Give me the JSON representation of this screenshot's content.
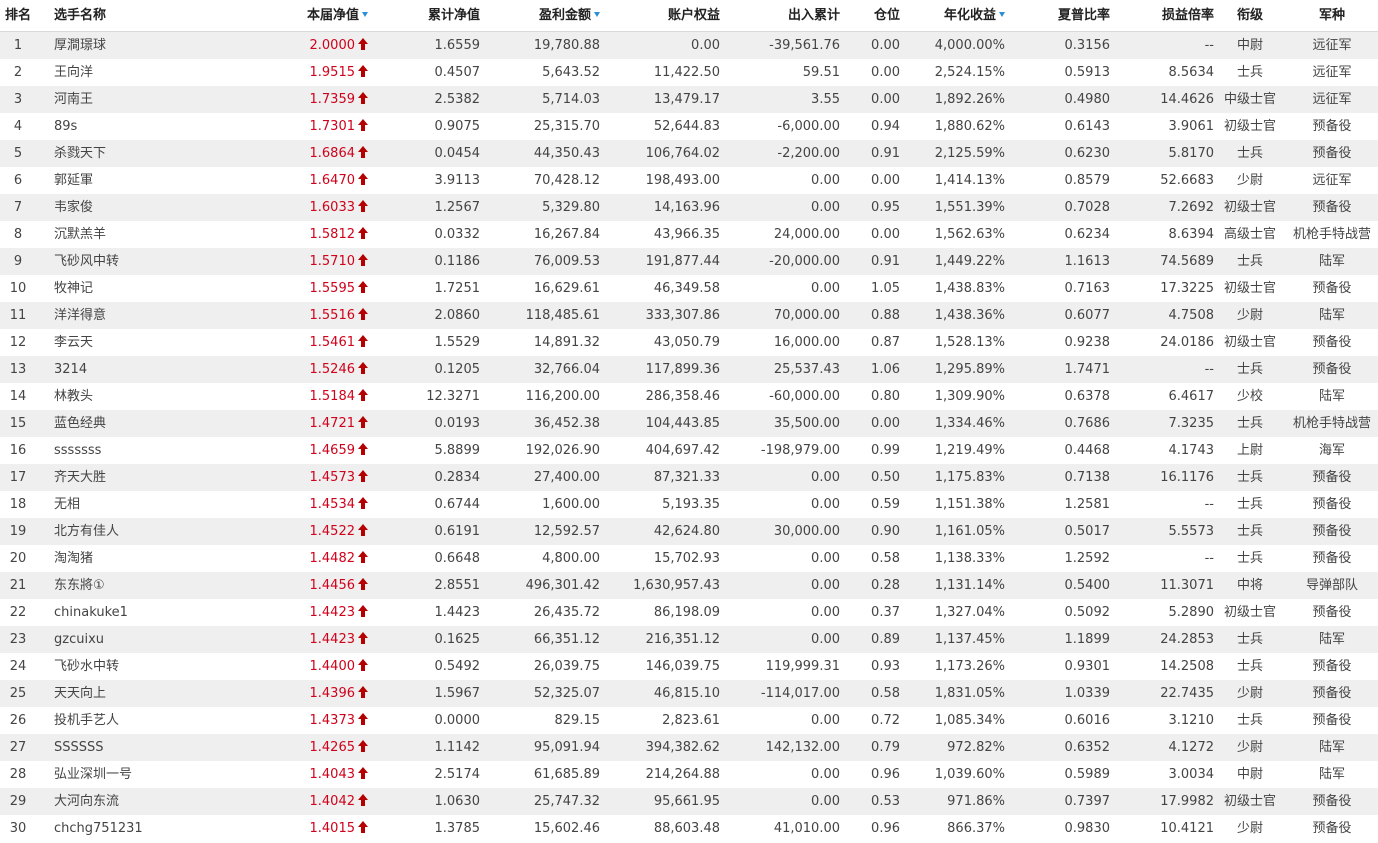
{
  "headers": {
    "rank": "排名",
    "name": "选手名称",
    "net": "本届净值",
    "cum": "累计净值",
    "profit": "盈利金额",
    "equity": "账户权益",
    "flow": "出入累计",
    "pos": "仓位",
    "annual": "年化收益",
    "sharpe": "夏普比率",
    "pl": "损益倍率",
    "rankname": "衔级",
    "branch": "军种"
  },
  "colors": {
    "accent": "#d0021b",
    "arrow": "#b40000",
    "sort": "#2a8fd6",
    "stripe": "#efefef"
  },
  "icons": {
    "sort": "sort-desc-icon",
    "trend": "up-arrow-icon"
  },
  "rows": [
    {
      "rank": "1",
      "name": "厚澗璟球",
      "net": "2.0000",
      "cum": "1.6559",
      "profit": "19,780.88",
      "equity": "0.00",
      "flow": "-39,561.76",
      "pos": "0.00",
      "annual": "4,000.00%",
      "sharpe": "0.3156",
      "pl": "--",
      "rankname": "中尉",
      "branch": "远征军"
    },
    {
      "rank": "2",
      "name": "王向洋",
      "net": "1.9515",
      "cum": "0.4507",
      "profit": "5,643.52",
      "equity": "11,422.50",
      "flow": "59.51",
      "pos": "0.00",
      "annual": "2,524.15%",
      "sharpe": "0.5913",
      "pl": "8.5634",
      "rankname": "士兵",
      "branch": "远征军"
    },
    {
      "rank": "3",
      "name": "河南王",
      "net": "1.7359",
      "cum": "2.5382",
      "profit": "5,714.03",
      "equity": "13,479.17",
      "flow": "3.55",
      "pos": "0.00",
      "annual": "1,892.26%",
      "sharpe": "0.4980",
      "pl": "14.4626",
      "rankname": "中级士官",
      "branch": "远征军"
    },
    {
      "rank": "4",
      "name": "89s",
      "net": "1.7301",
      "cum": "0.9075",
      "profit": "25,315.70",
      "equity": "52,644.83",
      "flow": "-6,000.00",
      "pos": "0.94",
      "annual": "1,880.62%",
      "sharpe": "0.6143",
      "pl": "3.9061",
      "rankname": "初级士官",
      "branch": "预备役"
    },
    {
      "rank": "5",
      "name": "杀戮天下",
      "net": "1.6864",
      "cum": "0.0454",
      "profit": "44,350.43",
      "equity": "106,764.02",
      "flow": "-2,200.00",
      "pos": "0.91",
      "annual": "2,125.59%",
      "sharpe": "0.6230",
      "pl": "5.8170",
      "rankname": "士兵",
      "branch": "预备役"
    },
    {
      "rank": "6",
      "name": "郭延軍",
      "net": "1.6470",
      "cum": "3.9113",
      "profit": "70,428.12",
      "equity": "198,493.00",
      "flow": "0.00",
      "pos": "0.00",
      "annual": "1,414.13%",
      "sharpe": "0.8579",
      "pl": "52.6683",
      "rankname": "少尉",
      "branch": "远征军"
    },
    {
      "rank": "7",
      "name": "韦家俊",
      "net": "1.6033",
      "cum": "1.2567",
      "profit": "5,329.80",
      "equity": "14,163.96",
      "flow": "0.00",
      "pos": "0.95",
      "annual": "1,551.39%",
      "sharpe": "0.7028",
      "pl": "7.2692",
      "rankname": "初级士官",
      "branch": "预备役"
    },
    {
      "rank": "8",
      "name": "沉默羔羊",
      "net": "1.5812",
      "cum": "0.0332",
      "profit": "16,267.84",
      "equity": "43,966.35",
      "flow": "24,000.00",
      "pos": "0.00",
      "annual": "1,562.63%",
      "sharpe": "0.6234",
      "pl": "8.6394",
      "rankname": "高级士官",
      "branch": "机枪手特战营"
    },
    {
      "rank": "9",
      "name": "飞砂风中转",
      "net": "1.5710",
      "cum": "0.1186",
      "profit": "76,009.53",
      "equity": "191,877.44",
      "flow": "-20,000.00",
      "pos": "0.91",
      "annual": "1,449.22%",
      "sharpe": "1.1613",
      "pl": "74.5689",
      "rankname": "士兵",
      "branch": "陆军"
    },
    {
      "rank": "10",
      "name": "牧神记",
      "net": "1.5595",
      "cum": "1.7251",
      "profit": "16,629.61",
      "equity": "46,349.58",
      "flow": "0.00",
      "pos": "1.05",
      "annual": "1,438.83%",
      "sharpe": "0.7163",
      "pl": "17.3225",
      "rankname": "初级士官",
      "branch": "预备役"
    },
    {
      "rank": "11",
      "name": "洋洋得意",
      "net": "1.5516",
      "cum": "2.0860",
      "profit": "118,485.61",
      "equity": "333,307.86",
      "flow": "70,000.00",
      "pos": "0.88",
      "annual": "1,438.36%",
      "sharpe": "0.6077",
      "pl": "4.7508",
      "rankname": "少尉",
      "branch": "陆军"
    },
    {
      "rank": "12",
      "name": "李云天",
      "net": "1.5461",
      "cum": "1.5529",
      "profit": "14,891.32",
      "equity": "43,050.79",
      "flow": "16,000.00",
      "pos": "0.87",
      "annual": "1,528.13%",
      "sharpe": "0.9238",
      "pl": "24.0186",
      "rankname": "初级士官",
      "branch": "预备役"
    },
    {
      "rank": "13",
      "name": "3214",
      "net": "1.5246",
      "cum": "0.1205",
      "profit": "32,766.04",
      "equity": "117,899.36",
      "flow": "25,537.43",
      "pos": "1.06",
      "annual": "1,295.89%",
      "sharpe": "1.7471",
      "pl": "--",
      "rankname": "士兵",
      "branch": "预备役"
    },
    {
      "rank": "14",
      "name": "林教头",
      "net": "1.5184",
      "cum": "12.3271",
      "profit": "116,200.00",
      "equity": "286,358.46",
      "flow": "-60,000.00",
      "pos": "0.80",
      "annual": "1,309.90%",
      "sharpe": "0.6378",
      "pl": "6.4617",
      "rankname": "少校",
      "branch": "陆军"
    },
    {
      "rank": "15",
      "name": "蓝色经典",
      "net": "1.4721",
      "cum": "0.0193",
      "profit": "36,452.38",
      "equity": "104,443.85",
      "flow": "35,500.00",
      "pos": "0.00",
      "annual": "1,334.46%",
      "sharpe": "0.7686",
      "pl": "7.3235",
      "rankname": "士兵",
      "branch": "机枪手特战营"
    },
    {
      "rank": "16",
      "name": "sssssss",
      "net": "1.4659",
      "cum": "5.8899",
      "profit": "192,026.90",
      "equity": "404,697.42",
      "flow": "-198,979.00",
      "pos": "0.99",
      "annual": "1,219.49%",
      "sharpe": "0.4468",
      "pl": "4.1743",
      "rankname": "上尉",
      "branch": "海军"
    },
    {
      "rank": "17",
      "name": "齐天大胜",
      "net": "1.4573",
      "cum": "0.2834",
      "profit": "27,400.00",
      "equity": "87,321.33",
      "flow": "0.00",
      "pos": "0.50",
      "annual": "1,175.83%",
      "sharpe": "0.7138",
      "pl": "16.1176",
      "rankname": "士兵",
      "branch": "预备役"
    },
    {
      "rank": "18",
      "name": "无相",
      "net": "1.4534",
      "cum": "0.6744",
      "profit": "1,600.00",
      "equity": "5,193.35",
      "flow": "0.00",
      "pos": "0.59",
      "annual": "1,151.38%",
      "sharpe": "1.2581",
      "pl": "--",
      "rankname": "士兵",
      "branch": "预备役"
    },
    {
      "rank": "19",
      "name": "北方有佳人",
      "net": "1.4522",
      "cum": "0.6191",
      "profit": "12,592.57",
      "equity": "42,624.80",
      "flow": "30,000.00",
      "pos": "0.90",
      "annual": "1,161.05%",
      "sharpe": "0.5017",
      "pl": "5.5573",
      "rankname": "士兵",
      "branch": "预备役"
    },
    {
      "rank": "20",
      "name": "淘淘猪",
      "net": "1.4482",
      "cum": "0.6648",
      "profit": "4,800.00",
      "equity": "15,702.93",
      "flow": "0.00",
      "pos": "0.58",
      "annual": "1,138.33%",
      "sharpe": "1.2592",
      "pl": "--",
      "rankname": "士兵",
      "branch": "预备役"
    },
    {
      "rank": "21",
      "name": "东东將①",
      "net": "1.4456",
      "cum": "2.8551",
      "profit": "496,301.42",
      "equity": "1,630,957.43",
      "flow": "0.00",
      "pos": "0.28",
      "annual": "1,131.14%",
      "sharpe": "0.5400",
      "pl": "11.3071",
      "rankname": "中将",
      "branch": "导弹部队"
    },
    {
      "rank": "22",
      "name": "chinakuke1",
      "net": "1.4423",
      "cum": "1.4423",
      "profit": "26,435.72",
      "equity": "86,198.09",
      "flow": "0.00",
      "pos": "0.37",
      "annual": "1,327.04%",
      "sharpe": "0.5092",
      "pl": "5.2890",
      "rankname": "初级士官",
      "branch": "预备役"
    },
    {
      "rank": "23",
      "name": "gzcuixu",
      "net": "1.4423",
      "cum": "0.1625",
      "profit": "66,351.12",
      "equity": "216,351.12",
      "flow": "0.00",
      "pos": "0.89",
      "annual": "1,137.45%",
      "sharpe": "1.1899",
      "pl": "24.2853",
      "rankname": "士兵",
      "branch": "陆军"
    },
    {
      "rank": "24",
      "name": "飞砂水中转",
      "net": "1.4400",
      "cum": "0.5492",
      "profit": "26,039.75",
      "equity": "146,039.75",
      "flow": "119,999.31",
      "pos": "0.93",
      "annual": "1,173.26%",
      "sharpe": "0.9301",
      "pl": "14.2508",
      "rankname": "士兵",
      "branch": "预备役"
    },
    {
      "rank": "25",
      "name": "天天向上",
      "net": "1.4396",
      "cum": "1.5967",
      "profit": "52,325.07",
      "equity": "46,815.10",
      "flow": "-114,017.00",
      "pos": "0.58",
      "annual": "1,831.05%",
      "sharpe": "1.0339",
      "pl": "22.7435",
      "rankname": "少尉",
      "branch": "预备役"
    },
    {
      "rank": "26",
      "name": "投机手艺人",
      "net": "1.4373",
      "cum": "0.0000",
      "profit": "829.15",
      "equity": "2,823.61",
      "flow": "0.00",
      "pos": "0.72",
      "annual": "1,085.34%",
      "sharpe": "0.6016",
      "pl": "3.1210",
      "rankname": "士兵",
      "branch": "预备役"
    },
    {
      "rank": "27",
      "name": "SSSSSS",
      "net": "1.4265",
      "cum": "1.1142",
      "profit": "95,091.94",
      "equity": "394,382.62",
      "flow": "142,132.00",
      "pos": "0.79",
      "annual": "972.82%",
      "sharpe": "0.6352",
      "pl": "4.1272",
      "rankname": "少尉",
      "branch": "陆军"
    },
    {
      "rank": "28",
      "name": "弘业深圳一号",
      "net": "1.4043",
      "cum": "2.5174",
      "profit": "61,685.89",
      "equity": "214,264.88",
      "flow": "0.00",
      "pos": "0.96",
      "annual": "1,039.60%",
      "sharpe": "0.5989",
      "pl": "3.0034",
      "rankname": "中尉",
      "branch": "陆军"
    },
    {
      "rank": "29",
      "name": "大河向东流",
      "net": "1.4042",
      "cum": "1.0630",
      "profit": "25,747.32",
      "equity": "95,661.95",
      "flow": "0.00",
      "pos": "0.53",
      "annual": "971.86%",
      "sharpe": "0.7397",
      "pl": "17.9982",
      "rankname": "初级士官",
      "branch": "预备役"
    },
    {
      "rank": "30",
      "name": "chchg751231",
      "net": "1.4015",
      "cum": "1.3785",
      "profit": "15,602.46",
      "equity": "88,603.48",
      "flow": "41,010.00",
      "pos": "0.96",
      "annual": "866.37%",
      "sharpe": "0.9830",
      "pl": "10.4121",
      "rankname": "少尉",
      "branch": "预备役"
    }
  ]
}
